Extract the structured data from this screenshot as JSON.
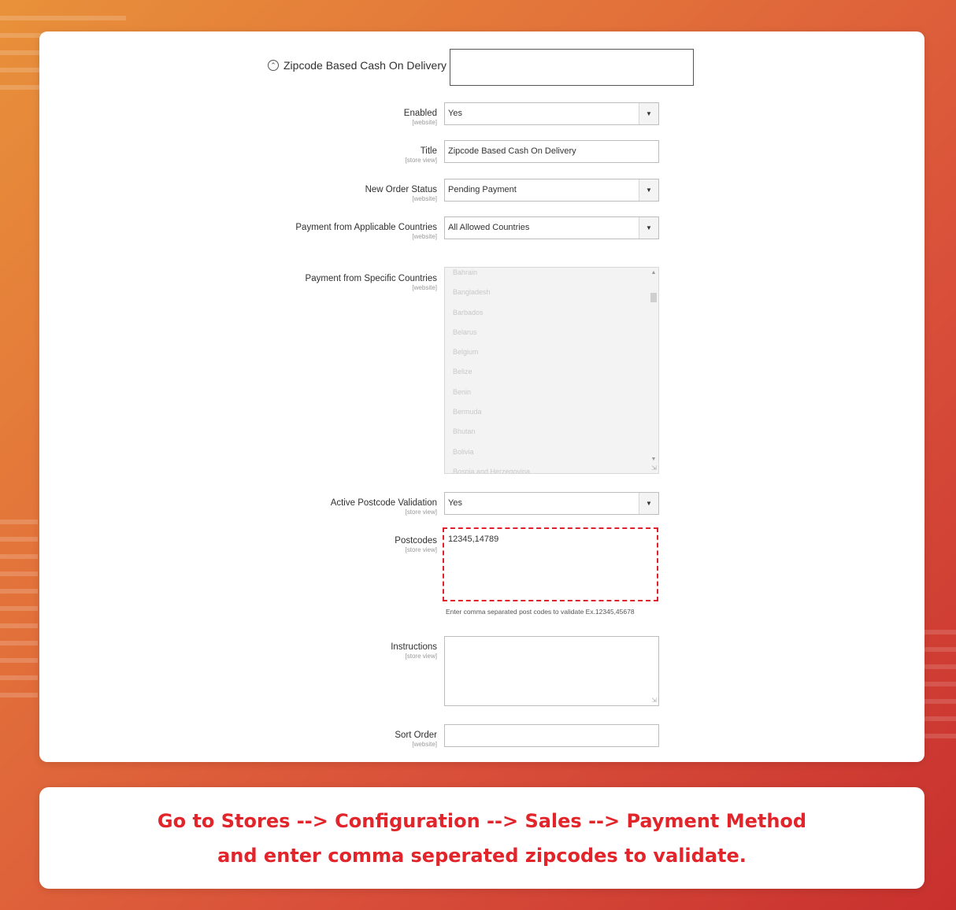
{
  "section": {
    "title": "Zipcode Based Cash On Delivery",
    "collapse_icon": "collapse-up-icon"
  },
  "fields": {
    "enabled": {
      "label": "Enabled",
      "scope": "[website]",
      "value": "Yes"
    },
    "title": {
      "label": "Title",
      "scope": "[store view]",
      "value": "Zipcode Based Cash On Delivery"
    },
    "new_order_status": {
      "label": "New Order Status",
      "scope": "[website]",
      "value": "Pending Payment"
    },
    "applicable_countries": {
      "label": "Payment from Applicable Countries",
      "scope": "[website]",
      "value": "All Allowed Countries"
    },
    "specific_countries": {
      "label": "Payment from Specific Countries",
      "scope": "[website]",
      "options": [
        "Bahrain",
        "Bangladesh",
        "Barbados",
        "Belarus",
        "Belgium",
        "Belize",
        "Benin",
        "Bermuda",
        "Bhutan",
        "Bolivia",
        "Bosnia and Herzegovina"
      ]
    },
    "postcode_validation": {
      "label": "Active Postcode Validation",
      "scope": "[store view]",
      "value": "Yes"
    },
    "postcodes": {
      "label": "Postcodes",
      "scope": "[store view]",
      "value": "12345,14789",
      "note": "Enter comma separated post codes to validate Ex.12345,45678"
    },
    "instructions": {
      "label": "Instructions",
      "scope": "[store view]",
      "value": ""
    },
    "sort_order": {
      "label": "Sort Order",
      "scope": "[website]",
      "value": ""
    }
  },
  "caption": {
    "line1": "Go to Stores --> Configuration --> Sales --> Payment Method",
    "line2": "and enter comma seperated zipcodes to validate."
  },
  "colors": {
    "highlight": "#e0202a",
    "caption_text": "#e1252b"
  }
}
